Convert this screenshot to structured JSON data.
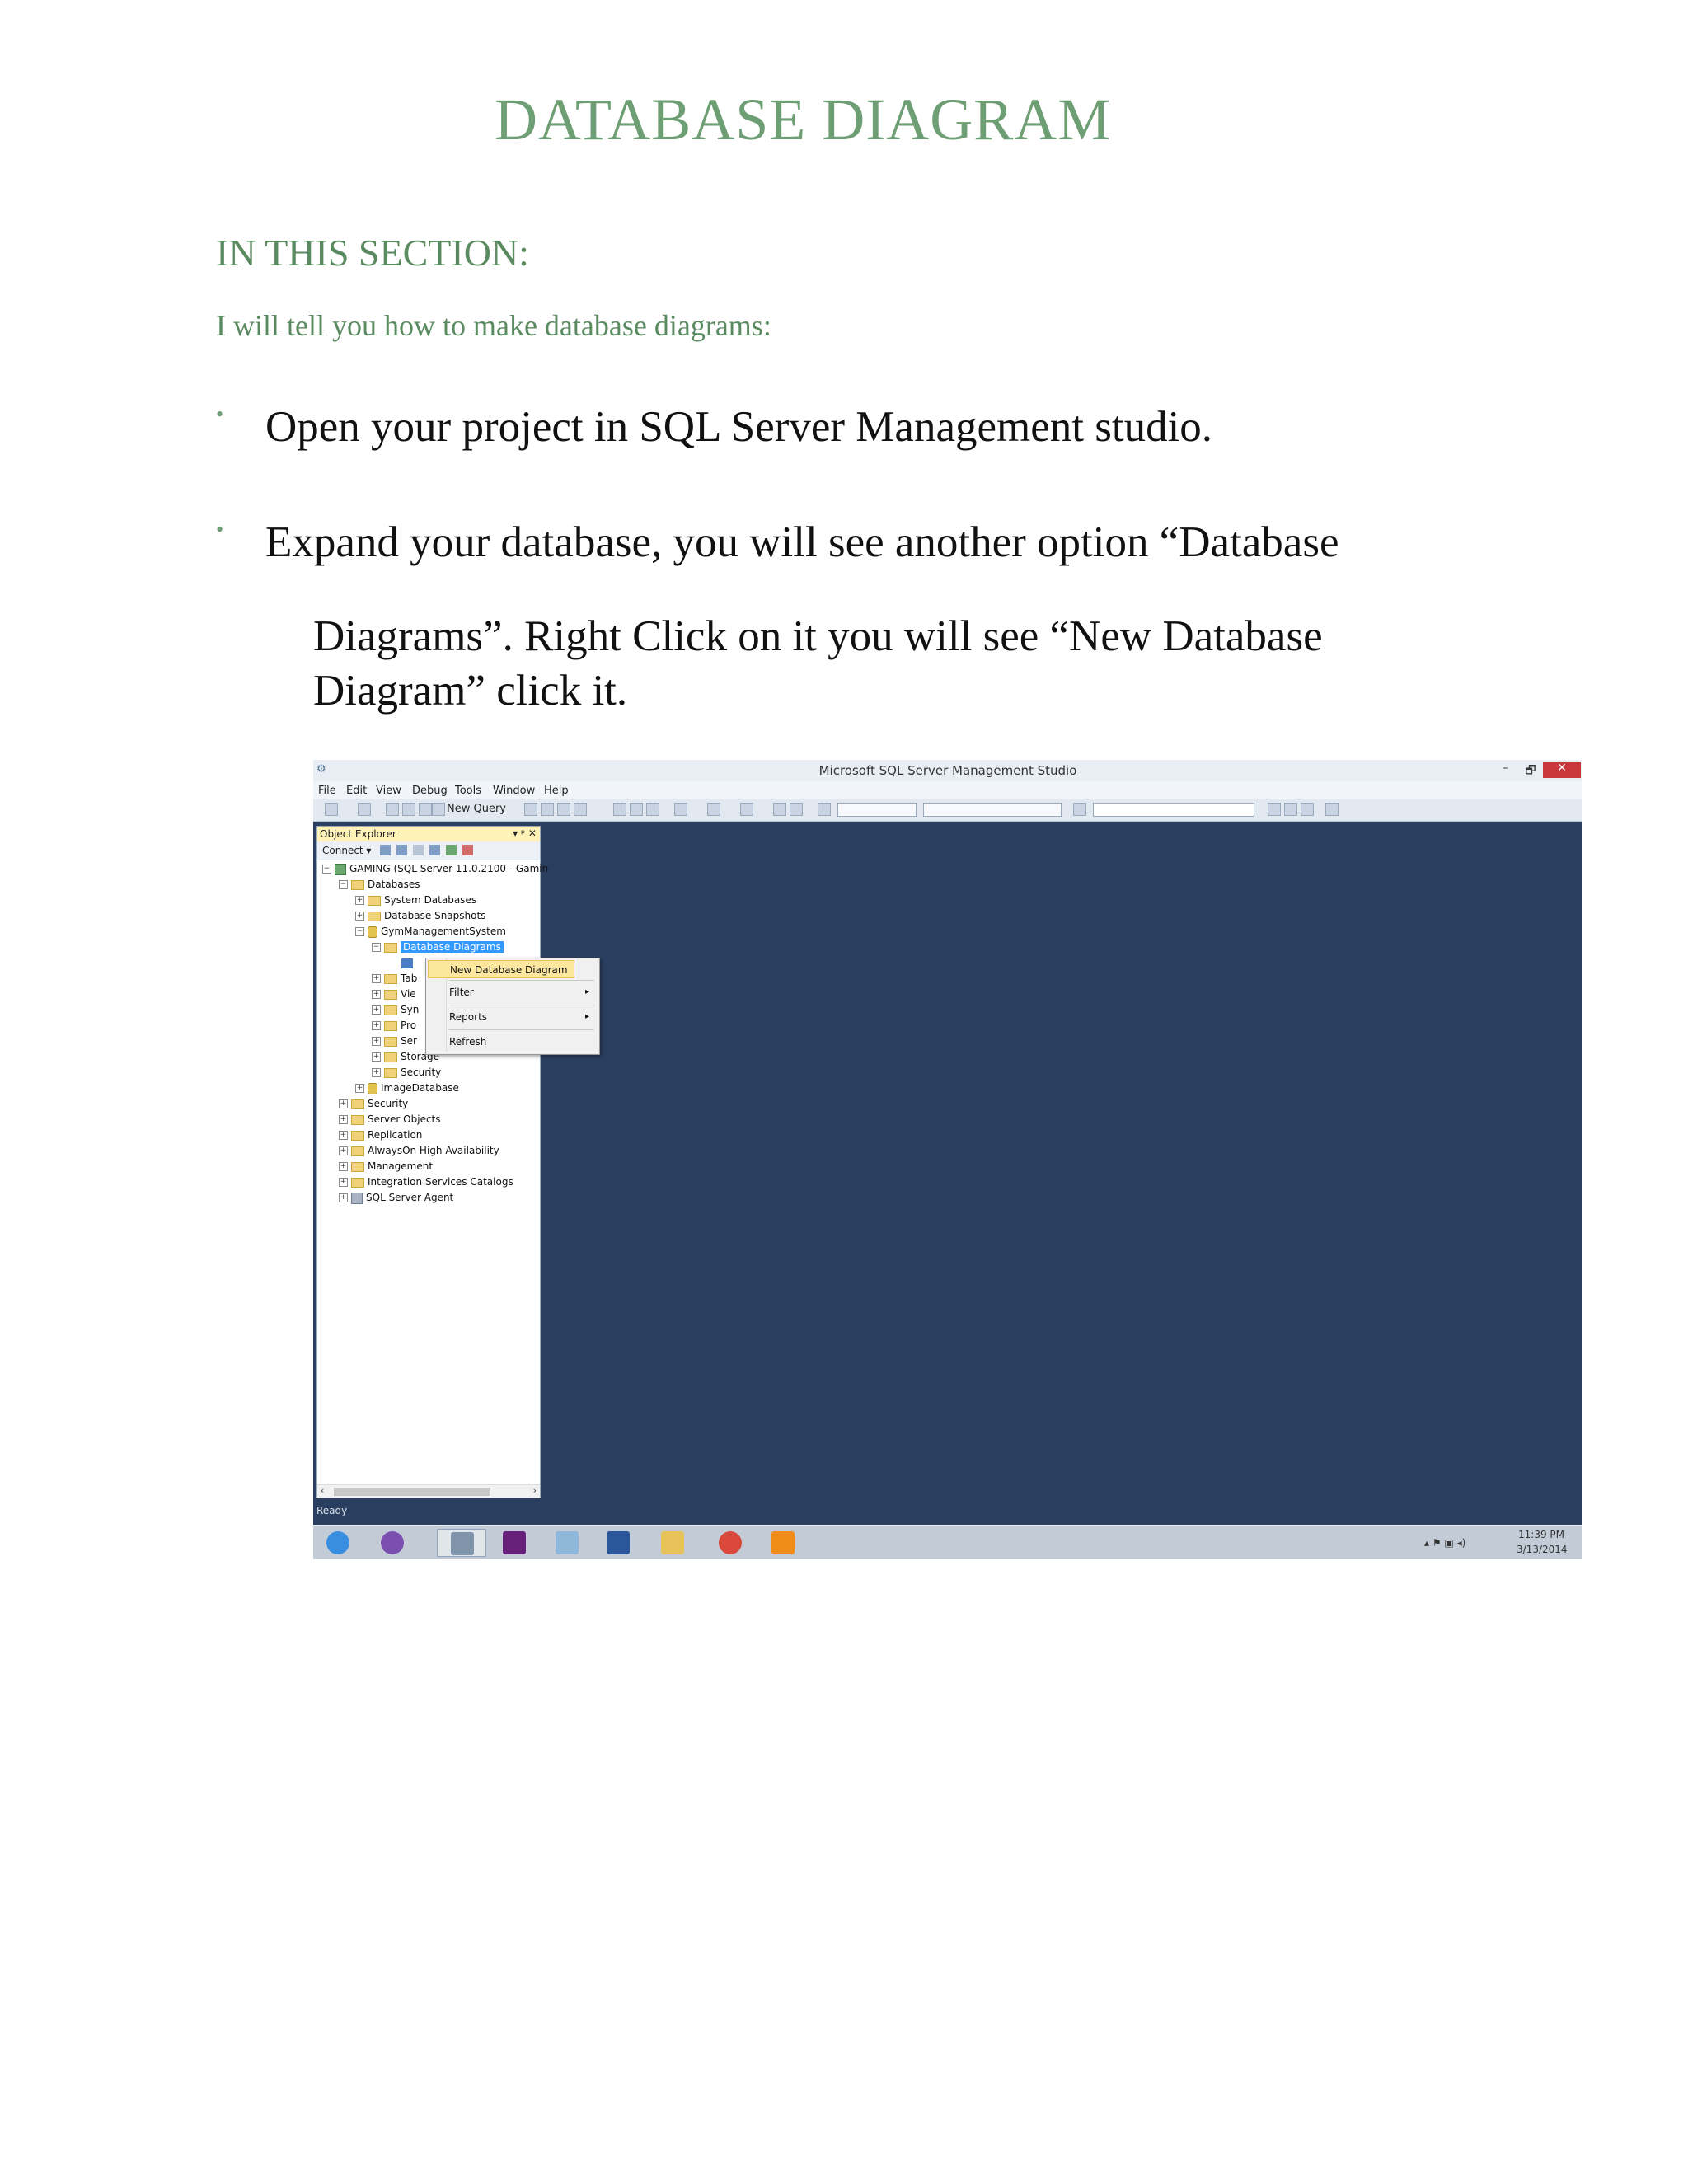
{
  "document": {
    "title": "DATABASE DIAGRAM",
    "section_heading": "IN THIS SECTION:",
    "intro": "I will tell you how to make database diagrams:",
    "bullets": [
      {
        "line1": "Open your project in SQL Server Management studio."
      },
      {
        "line1": "Expand your database, you will see another option “Database",
        "line2": "Diagrams”. Right Click on it you will see “New Database",
        "line3": "Diagram” click it."
      }
    ],
    "bullet_glyph": "•"
  },
  "screenshot": {
    "window_title": "Microsoft SQL Server Management Studio",
    "window_buttons": {
      "minimize": "–",
      "maximize": "🗗",
      "close": "✕"
    },
    "menu": [
      "File",
      "Edit",
      "View",
      "Debug",
      "Tools",
      "Window",
      "Help"
    ],
    "toolbar": {
      "new_query": "New Query"
    },
    "object_explorer": {
      "title": "Object Explorer",
      "header_buttons": "▾ ᵖ ✕",
      "connect": "Connect ▾",
      "tree": {
        "server": "GAMING (SQL Server 11.0.2100 - Gamin",
        "databases": "Databases",
        "system_databases": "System Databases",
        "database_snapshots": "Database Snapshots",
        "gym": "GymManagementSystem",
        "database_diagrams": "Database Diagrams",
        "tables": "Tab",
        "views": "Vie",
        "synonyms": "Syn",
        "programmability": "Pro",
        "service_broker": "Ser",
        "storage": "Storage",
        "security_db": "Security",
        "image_database": "ImageDatabase",
        "security": "Security",
        "server_objects": "Server Objects",
        "replication": "Replication",
        "alwayson": "AlwaysOn High Availability",
        "management": "Management",
        "integration": "Integration Services Catalogs",
        "sql_agent": "SQL Server Agent"
      }
    },
    "context_menu": {
      "new_database_diagram": "New Database Diagram",
      "filter": "Filter",
      "reports": "Reports",
      "refresh": "Refresh",
      "submenu_arrow": "▸"
    },
    "status": "Ready",
    "clock": {
      "time": "11:39 PM",
      "date": "3/13/2014"
    },
    "colors": {
      "workspace": "#2a3f5f",
      "title_green": "#6e9e73",
      "menu_highlight": "#fde79e",
      "selection": "#3399ff"
    }
  }
}
